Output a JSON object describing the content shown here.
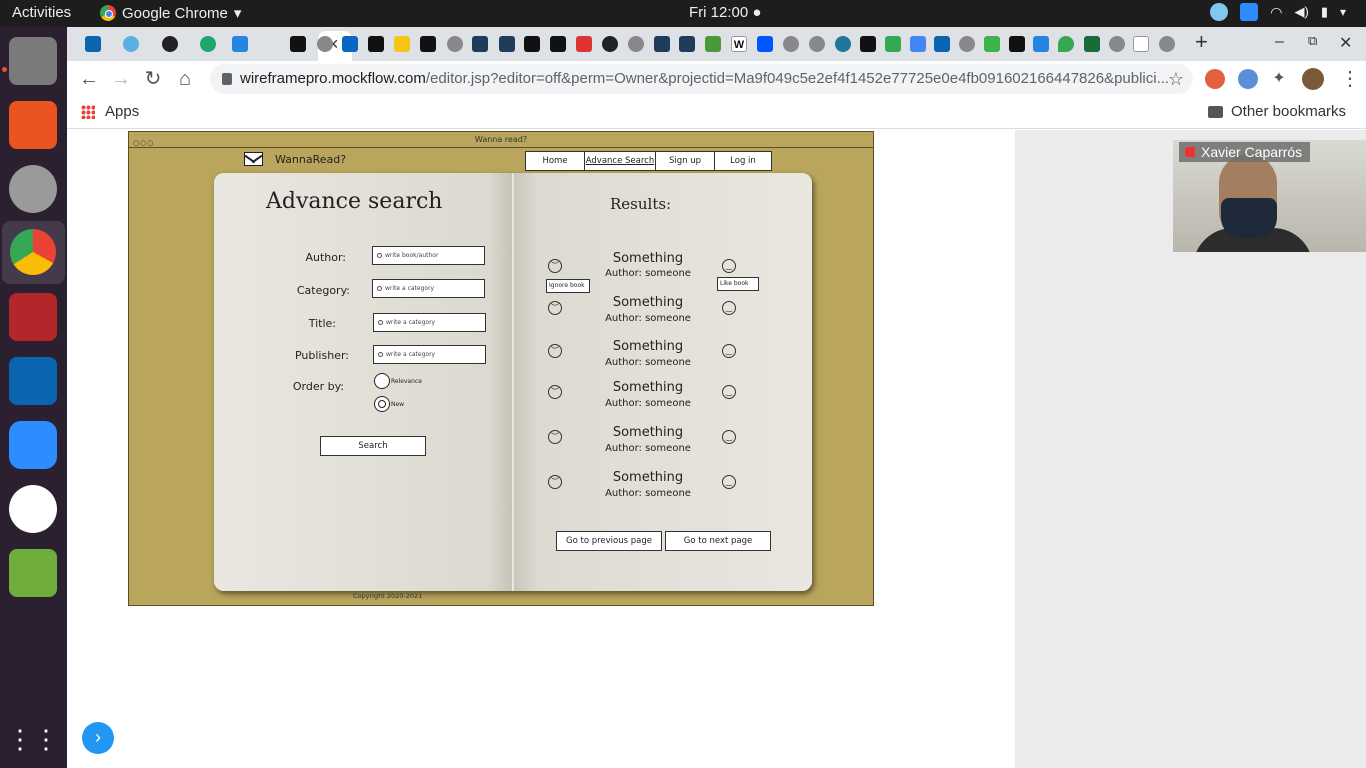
{
  "os": {
    "activities": "Activities",
    "app_name": "Google Chrome",
    "clock": "Fri 12:00 ●"
  },
  "browser": {
    "url_host": "wireframepro.mockflow.com",
    "url_path": "/editor.jsp?editor=off&perm=Owner&projectid=Ma9f049c5e2ef4f1452e77725e0e4fb091602166447826&publici...",
    "bookmarks": {
      "apps": "Apps",
      "other": "Other bookmarks"
    }
  },
  "wireframe": {
    "window_title": "Wanna read?",
    "logo_text": "WannaRead?",
    "nav": [
      "Home",
      "Advance Search",
      "Sign up",
      "Log in"
    ],
    "search": {
      "heading": "Advance search",
      "fields": [
        {
          "label": "Author:",
          "placeholder": "write book/author"
        },
        {
          "label": "Category:",
          "placeholder": "write a category"
        },
        {
          "label": "Title:",
          "placeholder": "write a category"
        },
        {
          "label": "Publisher:",
          "placeholder": "write a category"
        }
      ],
      "order_label": "Order by:",
      "order_options": [
        "Relevance",
        "New"
      ],
      "search_button": "Search"
    },
    "results": {
      "heading": "Results:",
      "items": [
        {
          "title": "Something",
          "author": "Author: someone"
        },
        {
          "title": "Something",
          "author": "Author: someone"
        },
        {
          "title": "Something",
          "author": "Author: someone"
        },
        {
          "title": "Something",
          "author": "Author: someone"
        },
        {
          "title": "Something",
          "author": "Author: someone"
        },
        {
          "title": "Something",
          "author": "Author: someone"
        }
      ],
      "ignore_tooltip": "Ignore book",
      "like_tooltip": "Like book",
      "prev_button": "Go to previous page",
      "next_button": "Go to next page"
    },
    "copyright": "Copyright 2020-2021"
  },
  "video_call": {
    "participant": "Xavier Caparrós"
  }
}
